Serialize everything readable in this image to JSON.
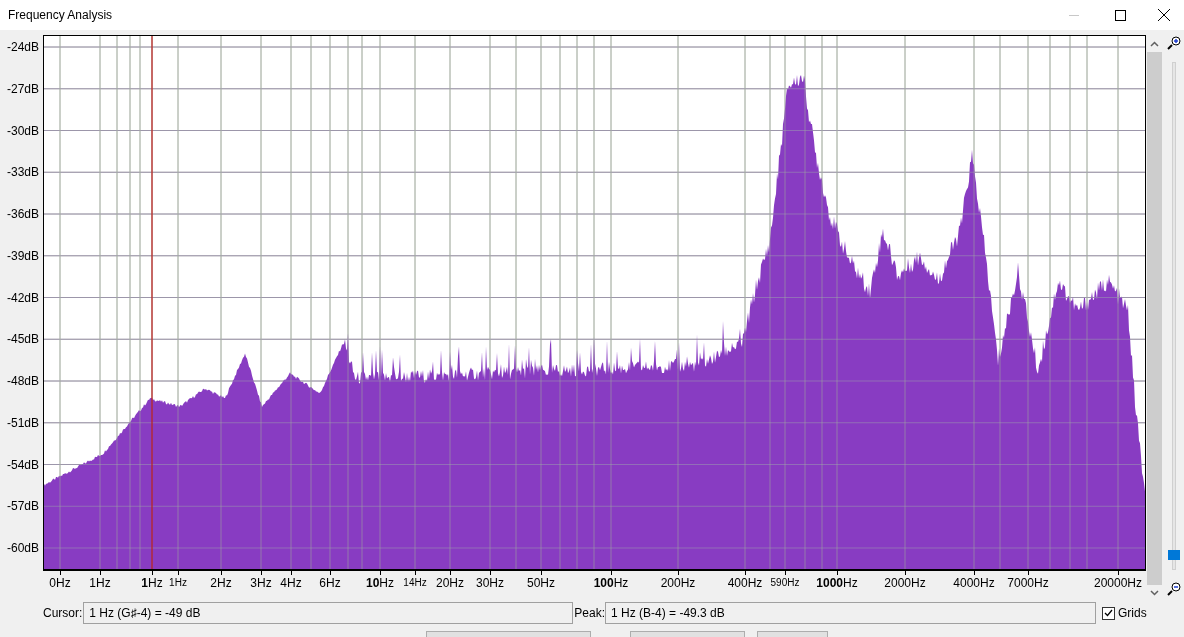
{
  "window": {
    "title": "Frequency Analysis"
  },
  "y_axis": {
    "ticks": [
      "-24dB",
      "-27dB",
      "-30dB",
      "-33dB",
      "-36dB",
      "-39dB",
      "-42dB",
      "-45dB",
      "-48dB",
      "-51dB",
      "-54dB",
      "-57dB",
      "-60dB"
    ]
  },
  "x_axis": {
    "ticks": [
      {
        "label": "0Hz",
        "kind": "normal"
      },
      {
        "label": "1Hz",
        "kind": "normal"
      },
      {
        "label": "**1**Hz",
        "kind": "normal"
      },
      {
        "label": "1Hz",
        "kind": "small"
      },
      {
        "label": "2Hz",
        "kind": "normal"
      },
      {
        "label": "3Hz",
        "kind": "normal"
      },
      {
        "label": "4Hz",
        "kind": "normal"
      },
      {
        "label": "6Hz",
        "kind": "normal"
      },
      {
        "label": "**10**Hz",
        "kind": "normal"
      },
      {
        "label": "14Hz",
        "kind": "small"
      },
      {
        "label": "20Hz",
        "kind": "normal"
      },
      {
        "label": "30Hz",
        "kind": "normal"
      },
      {
        "label": "50Hz",
        "kind": "normal"
      },
      {
        "label": "**100**Hz",
        "kind": "normal"
      },
      {
        "label": "200Hz",
        "kind": "normal"
      },
      {
        "label": "400Hz",
        "kind": "normal"
      },
      {
        "label": "590Hz",
        "kind": "small"
      },
      {
        "label": "**1000**Hz",
        "kind": "normal"
      },
      {
        "label": "2000Hz",
        "kind": "normal"
      },
      {
        "label": "4000Hz",
        "kind": "normal"
      },
      {
        "label": "7000Hz",
        "kind": "normal"
      },
      {
        "label": "20000Hz",
        "kind": "normal"
      }
    ]
  },
  "cursor": {
    "label": "Cursor:",
    "value": "1 Hz (G♯-4) = -49 dB"
  },
  "peak": {
    "label": "Peak:",
    "value": "1 Hz (B-4) = -49.3 dB"
  },
  "grids": {
    "label": "Grids",
    "checked": true
  },
  "zoom": {
    "level": 0.02
  }
}
